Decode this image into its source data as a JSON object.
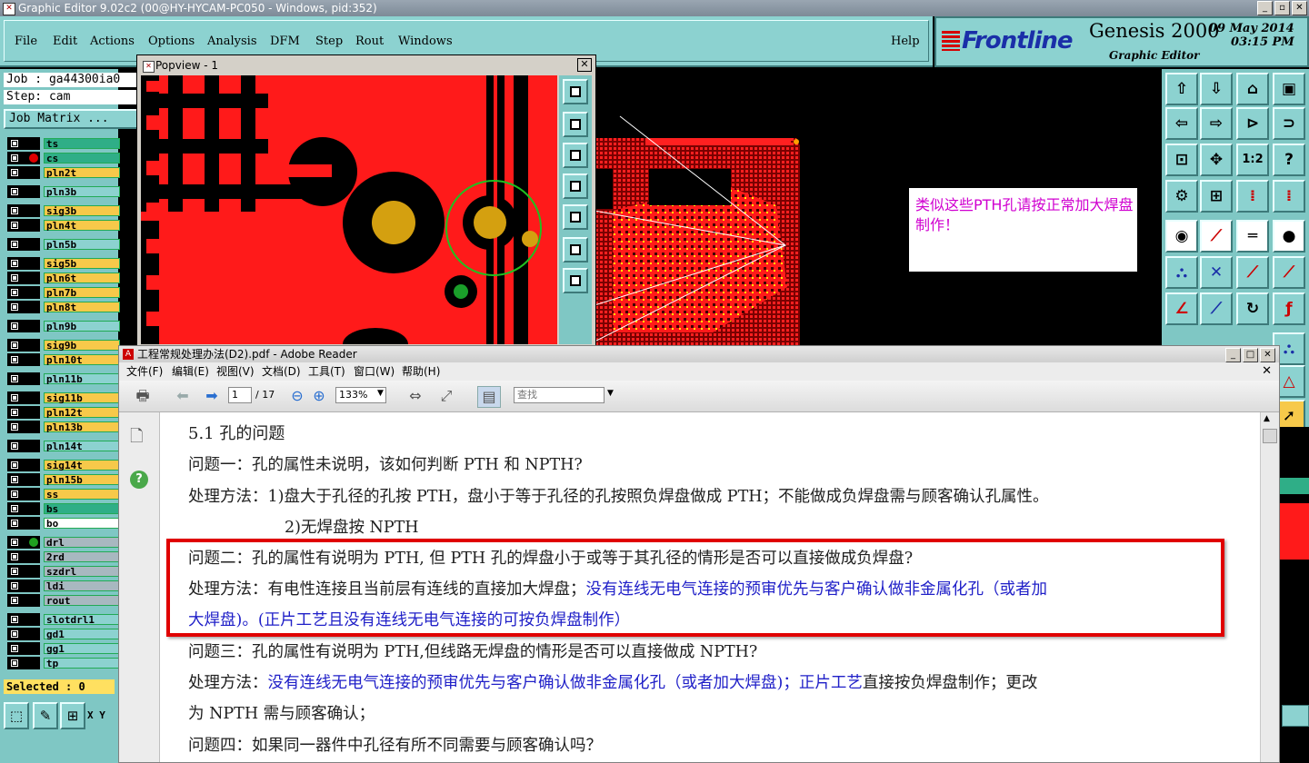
{
  "genesis": {
    "title": "Graphic Editor 9.02c2 (00@HY-HYCAM-PC050 - Windows, pid:352)",
    "menu": [
      "File",
      "Edit",
      "Actions",
      "Options",
      "Analysis",
      "DFM",
      "Step",
      "Rout",
      "Windows"
    ],
    "help": "Help",
    "brand": {
      "logo": "Frontline",
      "product": "Genesis 2000",
      "subtitle": "Graphic Editor",
      "date": "09 May 2014",
      "time": "03:15 PM"
    },
    "job": "Job : ga44300ia0",
    "step": "Step: cam",
    "job_matrix": "Job Matrix ...",
    "layers": [
      {
        "name": "ts",
        "color": "#2fae87"
      },
      {
        "name": "cs",
        "color": "#2fae87"
      },
      {
        "name": "pln2t",
        "color": "#f7c94a"
      },
      {
        "name": "pln3b",
        "color": "#8cd2d0"
      },
      {
        "name": "sig3b",
        "color": "#f7c94a"
      },
      {
        "name": "pln4t",
        "color": "#f7c94a"
      },
      {
        "name": "pln5b",
        "color": "#8cd2d0"
      },
      {
        "name": "sig5b",
        "color": "#f7c94a"
      },
      {
        "name": "pln6t",
        "color": "#f7c94a"
      },
      {
        "name": "pln7b",
        "color": "#f7c94a"
      },
      {
        "name": "pln8t",
        "color": "#f7c94a"
      },
      {
        "name": "pln9b",
        "color": "#8cd2d0"
      },
      {
        "name": "sig9b",
        "color": "#f7c94a"
      },
      {
        "name": "pln10t",
        "color": "#f7c94a"
      },
      {
        "name": "pln11b",
        "color": "#8cd2d0"
      },
      {
        "name": "sig11b",
        "color": "#f7c94a"
      },
      {
        "name": "pln12t",
        "color": "#f7c94a"
      },
      {
        "name": "pln13b",
        "color": "#f7c94a"
      },
      {
        "name": "pln14t",
        "color": "#8cd2d0"
      },
      {
        "name": "sig14t",
        "color": "#f7c94a"
      },
      {
        "name": "pln15b",
        "color": "#f7c94a"
      },
      {
        "name": "ss",
        "color": "#f7c94a"
      },
      {
        "name": "bs",
        "color": "#2fae87"
      },
      {
        "name": "bo",
        "color": "#ffffff"
      },
      {
        "name": "drl",
        "color": "#a8b8c0"
      },
      {
        "name": "2rd",
        "color": "#a8b8c0"
      },
      {
        "name": "szdrl",
        "color": "#a8b8c0"
      },
      {
        "name": "ldi",
        "color": "#a8b8c0"
      },
      {
        "name": "rout",
        "color": "#a8b8c0"
      },
      {
        "name": "slotdrl1",
        "color": "#8cd2d0"
      },
      {
        "name": "gd1",
        "color": "#8cd2d0"
      },
      {
        "name": "gg1",
        "color": "#8cd2d0"
      },
      {
        "name": "tp",
        "color": "#8cd2d0"
      }
    ],
    "selected": "Selected : 0",
    "xy": "X Y",
    "popview_title": "Popview - 1",
    "note": "类似这些PTH孔请按正常加大焊盘制作！"
  },
  "reader": {
    "title": "工程常规处理办法(D2).pdf - Adobe Reader",
    "menu": [
      "文件(F)",
      "编辑(E)",
      "视图(V)",
      "文档(D)",
      "工具(T)",
      "窗口(W)",
      "帮助(H)"
    ],
    "page_current": "1",
    "page_total": "/ 17",
    "zoom": "133%",
    "search_placeholder": "查找",
    "lines": [
      {
        "text": "5.1 孔的问题"
      },
      {
        "text": "问题一：孔的属性未说明，该如何判断 PTH 和 NPTH?"
      },
      {
        "text": "处理方法：1)盘大于孔径的孔按 PTH，盘小于等于孔径的孔按照负焊盘做成 PTH；不能做成负焊盘需与顾客确认孔属性。"
      },
      {
        "text": "2)无焊盘按 NPTH"
      },
      {
        "text": "问题二：孔的属性有说明为 PTH, 但 PTH 孔的焊盘小于或等于其孔径的情形是否可以直接做成负焊盘?"
      },
      {
        "a": "处理方法：有电性连接且当前层有连线的直接加大焊盘；",
        "b": "没有连线无电气连接的预审优先与客户确认做非金属化孔（或者加"
      },
      {
        "b": "大焊盘)。(正片工艺且没有连线无电气连接的可按负焊盘制作）"
      },
      {
        "text": "问题三：孔的属性有说明为 PTH,但线路无焊盘的情形是否可以直接做成 NPTH?"
      },
      {
        "a": "处理方法：",
        "b": "没有连线无电气连接的预审优先与客户确认做非金属化孔（或者加大焊盘)；",
        "c": "正片工艺",
        "d": "直接按负焊盘制作；更改"
      },
      {
        "text": "为 NPTH 需与顾客确认；"
      },
      {
        "text": "问题四：如果同一器件中孔径有所不同需要与顾客确认吗？"
      }
    ]
  }
}
